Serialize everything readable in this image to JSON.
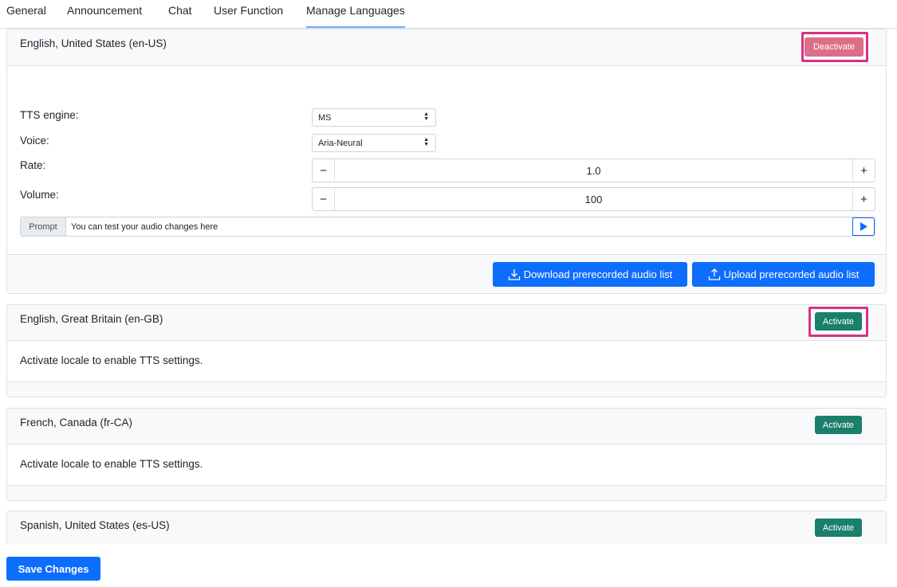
{
  "tabs": [
    "General",
    "Announcement",
    "Chat",
    "User Function",
    "Manage Languages"
  ],
  "locales": [
    {
      "name": "English, United States (en-US)",
      "button": "Deactivate"
    },
    {
      "name": "English, Great Britain (en-GB)",
      "button": "Activate",
      "message": "Activate locale to enable TTS settings."
    },
    {
      "name": "French, Canada (fr-CA)",
      "button": "Activate",
      "message": "Activate locale to enable TTS settings."
    },
    {
      "name": "Spanish, United States (es-US)",
      "button": "Activate"
    }
  ],
  "tts": {
    "engine_label": "TTS engine:",
    "engine_value": "MS",
    "voice_label": "Voice:",
    "voice_value": "Aria-Neural",
    "rate_label": "Rate:",
    "rate_value": "1.0",
    "volume_label": "Volume:",
    "volume_value": "100",
    "minus": "−",
    "plus": "+",
    "prompt_label": "Prompt",
    "prompt_text": "You can test your audio changes here"
  },
  "audio_buttons": {
    "download": "Download prerecorded audio list",
    "upload": "Upload prerecorded audio list"
  },
  "save_button": "Save Changes",
  "colors": {
    "primary": "#0d6efd",
    "activate": "#1a7f6b",
    "deactivate": "#de6e87",
    "highlight": "#d63384"
  }
}
